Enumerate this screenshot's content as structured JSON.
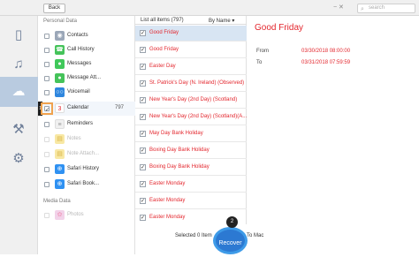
{
  "topbar": {
    "back": "Back",
    "search_placeholder": "search"
  },
  "sidebar": {
    "personal_heading": "Personal Data",
    "items": [
      {
        "label": "Contacts",
        "icon": "contacts-icon",
        "color": "#9ba7b8"
      },
      {
        "label": "Call History",
        "icon": "phone-icon",
        "color": "#45c35a"
      },
      {
        "label": "Messages",
        "icon": "messages-icon",
        "color": "#40c85a"
      },
      {
        "label": "Message Att...",
        "icon": "message-attachment-icon",
        "color": "#45c35a"
      },
      {
        "label": "Voicemail",
        "icon": "voicemail-icon",
        "color": "#2e86de"
      },
      {
        "label": "Calendar",
        "count": "797",
        "icon": "calendar-icon",
        "color": "#ffffff"
      },
      {
        "label": "Reminders",
        "icon": "reminders-icon",
        "color": "#f0f0f0"
      },
      {
        "label": "Notes",
        "icon": "notes-icon",
        "color": "#f5d66b"
      },
      {
        "label": "Note Attach...",
        "icon": "note-attachment-icon",
        "color": "#f5d66b"
      },
      {
        "label": "Safari History",
        "icon": "safari-icon",
        "color": "#2f91f2"
      },
      {
        "label": "Safari Book...",
        "icon": "safari-bookmark-icon",
        "color": "#2f91f2"
      }
    ],
    "media_heading": "Media Data",
    "media_item": {
      "label": "Photos",
      "icon": "photos-icon"
    },
    "marker": "1"
  },
  "list": {
    "title": "List all items (797)",
    "sort": "By Name",
    "items": [
      "Good Friday",
      "Good Friday",
      "Easter Day",
      "St. Patrick's Day (N. Ireland) (Observed)",
      "New Year's Day (2nd Day) (Scotland)",
      "New Year's Day (2nd Day) (Scotland)(A...",
      "May Day Bank Holiday",
      "Boxing Day Bank Holiday",
      "Boxing Day Bank Holiday",
      "Easter Monday",
      "Easter Monday",
      "Easter Monday"
    ]
  },
  "detail": {
    "title": "Good Friday",
    "from_label": "From",
    "from_value": "03/30/2018 08:00:00",
    "to_label": "To",
    "to_value": "03/31/2018 07:59:59"
  },
  "footer": {
    "selected": "Selected 0 Item",
    "recover": "Recover",
    "badge": "2",
    "to_mac": "To Mac"
  },
  "colors": {
    "accent": "#e3262d",
    "selected_row": "#d8e5f3",
    "cloud_bg": "#b9cbe0",
    "recover": "#2c79d2"
  }
}
